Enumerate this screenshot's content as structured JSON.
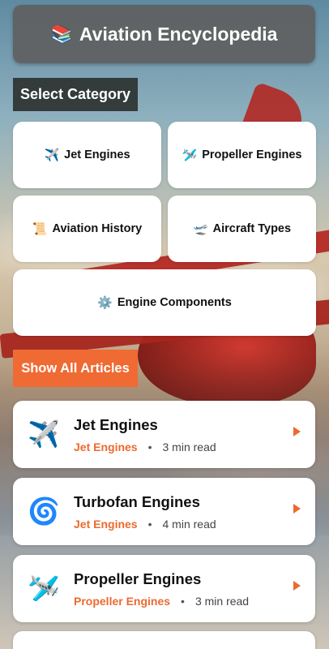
{
  "app": {
    "title": "Aviation Encyclopedia",
    "title_icon": "books-icon"
  },
  "categories": {
    "section_label": "Select Category",
    "items": [
      {
        "label": "Jet Engines",
        "icon": "✈️"
      },
      {
        "label": "Propeller Engines",
        "icon": "🛩️"
      },
      {
        "label": "Aviation History",
        "icon": "📜"
      },
      {
        "label": "Aircraft Types",
        "icon": "🛫"
      },
      {
        "label": "Engine Components",
        "icon": "⚙️"
      }
    ]
  },
  "show_all_label": "Show All Articles",
  "articles": [
    {
      "title": "Jet Engines",
      "category": "Jet Engines",
      "read_time": "3 min read",
      "icon": "✈️"
    },
    {
      "title": "Turbofan Engines",
      "category": "Jet Engines",
      "read_time": "4 min read",
      "icon": "🌀"
    },
    {
      "title": "Propeller Engines",
      "category": "Propeller Engines",
      "read_time": "3 min read",
      "icon": "🛩️"
    }
  ],
  "colors": {
    "accent": "#f06a33",
    "title_bar": "#5f5f5f",
    "section_label_bg": "#282c2a"
  }
}
